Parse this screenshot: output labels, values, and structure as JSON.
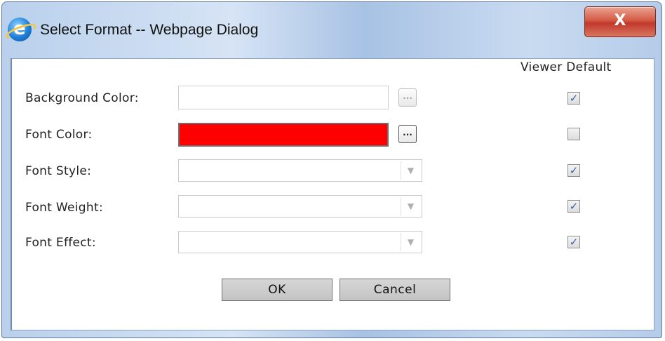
{
  "window": {
    "title": "Select Format -- Webpage Dialog",
    "close_glyph": "X"
  },
  "columns": {
    "viewer_default": "Viewer Default"
  },
  "rows": [
    {
      "label": "Background Color:",
      "control": "color",
      "value": "",
      "picker": "...",
      "viewer_default": true
    },
    {
      "label": "Font Color:",
      "control": "color",
      "value": "#FF0000",
      "picker": "...",
      "viewer_default": false
    },
    {
      "label": "Font Style:",
      "control": "select",
      "value": "",
      "viewer_default": true
    },
    {
      "label": "Font Weight:",
      "control": "select",
      "value": "",
      "viewer_default": true
    },
    {
      "label": "Font Effect:",
      "control": "select",
      "value": "",
      "viewer_default": true
    }
  ],
  "buttons": {
    "ok": "OK",
    "cancel": "Cancel"
  },
  "icons": {
    "app": "ie-icon",
    "dropdown": "chevron-down-icon",
    "check": "✓"
  }
}
